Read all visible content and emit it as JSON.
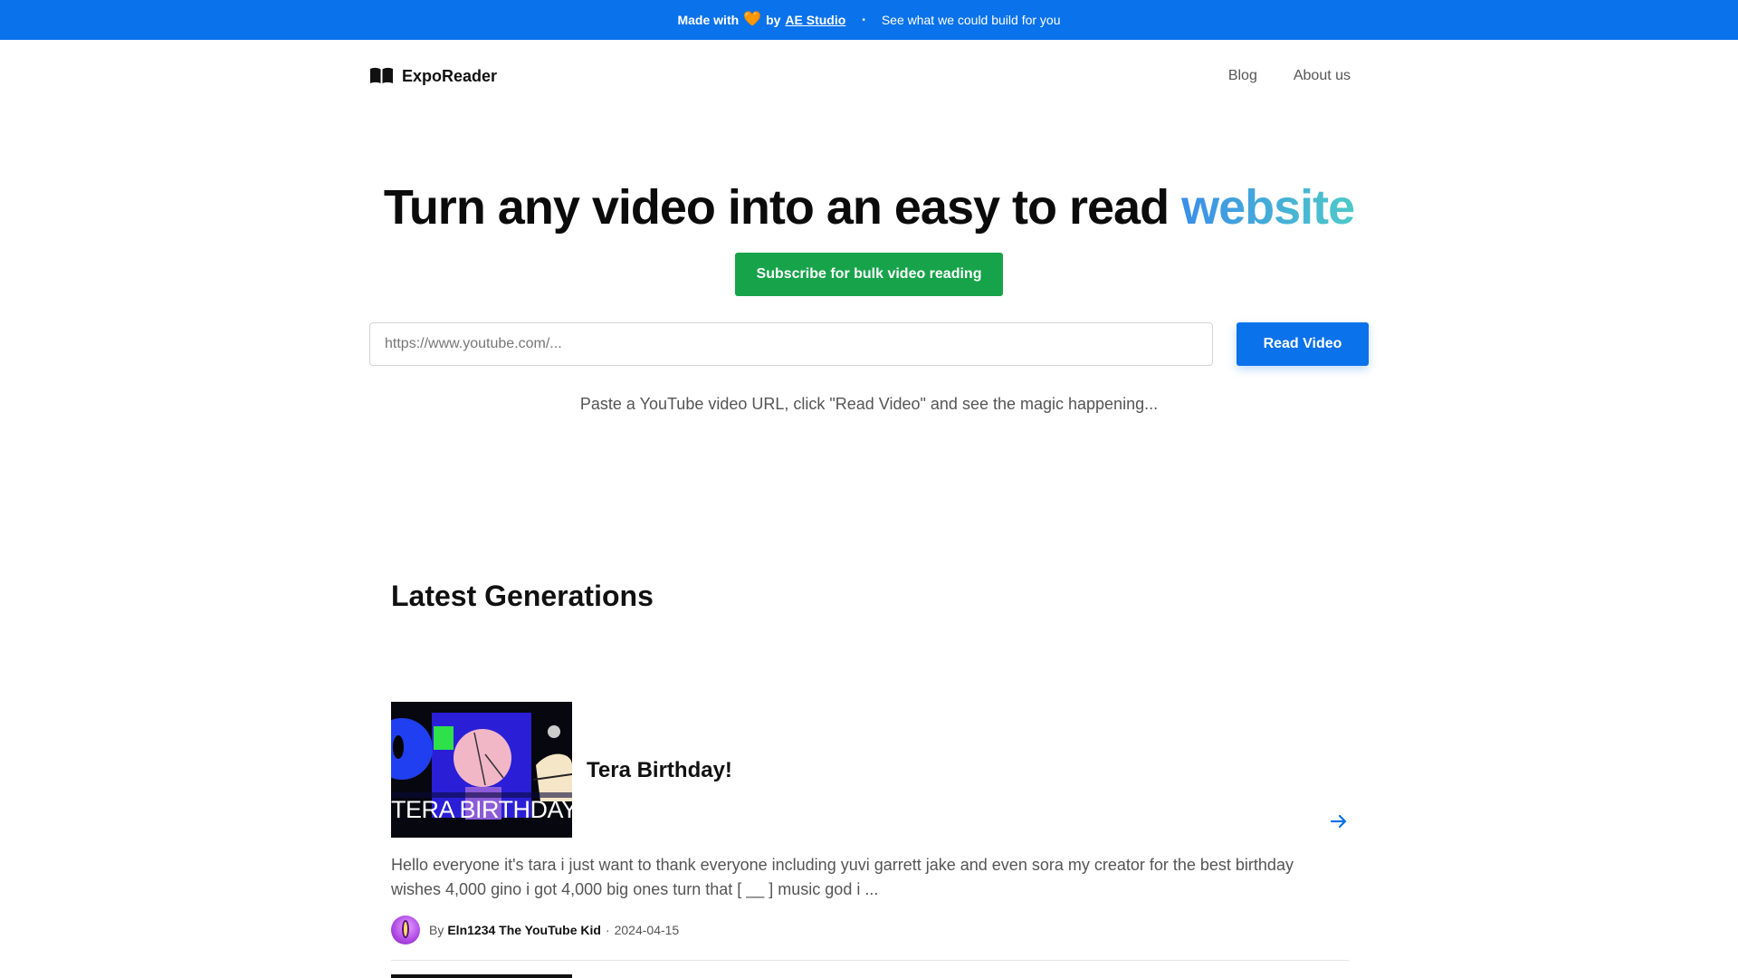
{
  "banner": {
    "made_with": "Made with",
    "heart": "🧡",
    "by": "by",
    "studio": "AE Studio",
    "separator": "•",
    "cta": "See what we could build for you",
    "color": "#0a72ea"
  },
  "nav": {
    "brand": "ExpoReader",
    "brand_icon": "open-book-icon",
    "links": [
      "Blog",
      "About us"
    ]
  },
  "hero": {
    "title_main": "Turn any video into an easy to read",
    "title_accent": "website",
    "subscribe_label": "Subscribe for bulk video reading",
    "subscribe_color": "#17a34a",
    "input_placeholder": "https://www.youtube.com/...",
    "read_button": "Read Video",
    "hint": "Paste a YouTube video URL, click \"Read Video\" and see the magic happening..."
  },
  "latest": {
    "heading": "Latest Generations",
    "items": [
      {
        "title": "Tera Birthday!",
        "thumbnail_caption": "TERA BIRTHDAY!",
        "description": "Hello everyone it's tara i just want to thank everyone including yuvi garrett jake and even sora my creator for the best birthday wishes 4,000 gino i got 4,000 big ones turn that [ __ ] music god i ...",
        "by": "By",
        "author": "Eln1234 The YouTube Kid",
        "separator": "·",
        "date": "2024-04-15",
        "arrow_icon": "arrow-right-icon"
      }
    ]
  }
}
